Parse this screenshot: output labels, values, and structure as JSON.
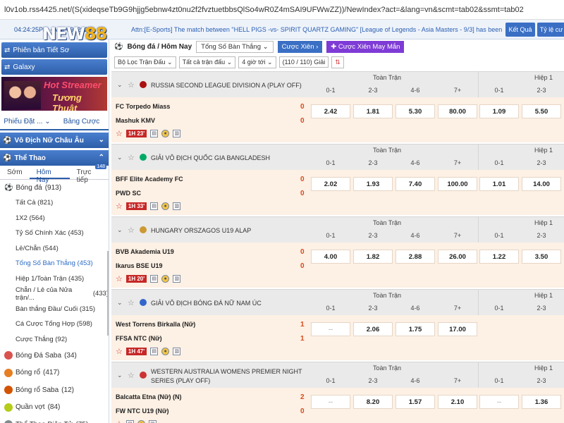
{
  "browser": {
    "url": "l0v1ob.rss4425.net/(S(xideqseTb9G9hjjg5ebnw4zt0nu2f2fvztuetbbsQlSo4wR0Z4mSAI9UFWwZZ))/NewIndex?act=&lang=vn&scmt=tab02&ssmt=tab02"
  },
  "top": {
    "clock": "04:24:25PM - Mar 09, 2025",
    "logo_a": "NEW",
    "logo_b": "88",
    "marquee": "Attn:[E-Sports] The match between \"HELL PIGS -vs- SPIRIT QUARTZ GAMING\" [League of Legends - Asia Masters - 9/3] has been",
    "btn_result": "Kết Quả",
    "btn_rate": "Tỷ lệ cư"
  },
  "sidebar": {
    "version_btn": "Phiên bản Tiết Sơ",
    "galaxy_btn": "Galaxy",
    "banner": {
      "line1": "Hot Streamer",
      "line2": "Tương Thuật"
    },
    "tab_bet": "Phiếu Đặt ...",
    "tab_odds": "Bảng Cược",
    "sec_women": "Vô Địch Nữ Châu Âu",
    "sec_sport": "Thể Thao",
    "tabs": [
      "Sớm",
      "Hôm Nay",
      "Trực tiếp"
    ],
    "live_count": "148",
    "football": "Bóng đá",
    "football_count": "(913)",
    "subs": [
      {
        "label": "Tất Cả",
        "count": "(821)"
      },
      {
        "label": "1X2",
        "count": "(564)"
      },
      {
        "label": "Tỷ Số Chính Xác",
        "count": "(453)"
      },
      {
        "label": "Lẻ/Chẵn",
        "count": "(544)"
      },
      {
        "label": "Tổng Số Bàn Thắng",
        "count": "(453)"
      },
      {
        "label": "Hiệp 1/Toàn Trận",
        "count": "(435)"
      },
      {
        "label": "Chẵn / Lẻ của Nửa trận/...",
        "count": "(433)"
      },
      {
        "label": "Bàn thắng Đầu/ Cuối",
        "count": "(315)"
      },
      {
        "label": "Cá Cược Tổng Hợp",
        "count": "(598)"
      },
      {
        "label": "Cược Thắng",
        "count": "(92)"
      }
    ],
    "sports": [
      {
        "label": "Bóng Đá Saba",
        "count": "(34)",
        "color": "#d9534f"
      },
      {
        "label": "Bóng rổ",
        "count": "(417)",
        "color": "#e67e22"
      },
      {
        "label": "Bóng rổ Saba",
        "count": "(12)",
        "color": "#d35400"
      },
      {
        "label": "Quần vợt",
        "count": "(84)",
        "color": "#b5cc18"
      },
      {
        "label": "Thể Thao Điện Tử",
        "count": "(75)",
        "color": "#7f8c8d"
      }
    ]
  },
  "main": {
    "title": "Bóng đá / Hôm Nay",
    "market": "Tổng Số Bàn Thắng",
    "parlay": "Cược Xiên",
    "parlay_lucky": "Cược Xiên May Mắn",
    "filter_league": "Bộ Lọc Trận Đấu",
    "filter_all": "Tất cả trận đấu",
    "filter_time": "4 giờ tới",
    "filter_count": "(110 / 110) Giải",
    "col_full": "Toàn Trận",
    "col_half": "Hiệp 1",
    "heads": [
      "0-1",
      "2-3",
      "4-6",
      "7+",
      "0-1",
      "2-3"
    ],
    "leagues": [
      {
        "name": "RUSSIA SECOND LEAGUE DIVISION A (PLAY OFF)",
        "flag": "#a11",
        "home": "FC Torpedo Miass",
        "away": "Mashuk KMV",
        "hs": "0",
        "as": "0",
        "time": "1H 23'",
        "odds": [
          "2.42",
          "1.81",
          "5.30",
          "80.00",
          "1.09",
          "5.50"
        ]
      },
      {
        "name": "GIẢI VÔ ĐỊCH QUỐC GIA BANGLADESH",
        "flag": "#0a6",
        "home": "BFF Elite Academy FC",
        "away": "PWD SC",
        "hs": "0",
        "as": "0",
        "time": "1H 33'",
        "odds": [
          "2.02",
          "1.93",
          "7.40",
          "100.00",
          "1.01",
          "14.00"
        ]
      },
      {
        "name": "HUNGARY ORSZAGOS U19 ALAP",
        "flag": "#c93",
        "home": "BVB Akademia U19",
        "away": "Ikarus BSE U19",
        "hs": "0",
        "as": "0",
        "time": "1H 20'",
        "odds": [
          "4.00",
          "1.82",
          "2.88",
          "26.00",
          "1.22",
          "3.50"
        ]
      },
      {
        "name": "GIẢI VÔ ĐỊCH BÓNG ĐÁ NỮ NAM ÚC",
        "flag": "#36c",
        "home": "West Torrens Birkalla (Nữ)",
        "away": "FFSA NTC (Nữ)",
        "hs": "1",
        "as": "1",
        "time": "1H 47'",
        "odds": [
          "--",
          "2.06",
          "1.75",
          "17.00",
          "",
          ""
        ]
      },
      {
        "name": "WESTERN AUSTRALIA WOMENS PREMIER NIGHT SERIES (PLAY OFF)",
        "flag": "#c33",
        "home": "Balcatta Etna (Nữ) (N)",
        "away": "FW NTC U19 (Nữ)",
        "hs": "2",
        "as": "0",
        "time": "",
        "odds": [
          "--",
          "8.20",
          "1.57",
          "2.10",
          "--",
          "1.36"
        ]
      }
    ]
  }
}
